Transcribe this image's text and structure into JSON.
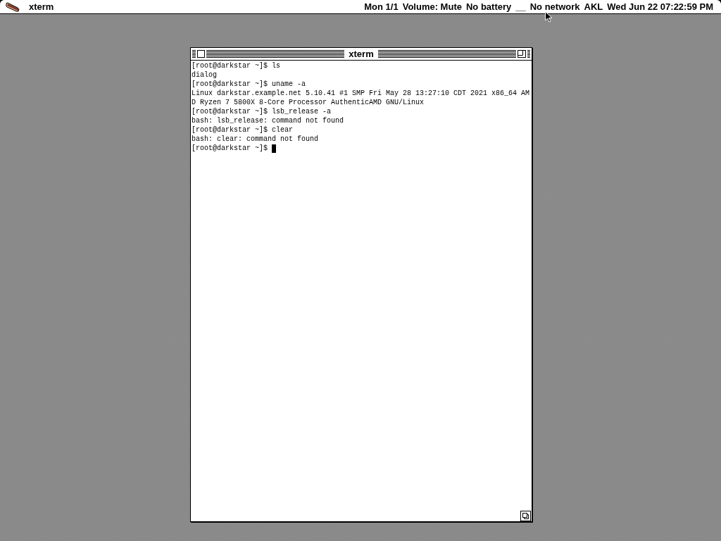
{
  "menu_bar": {
    "app_menu": "xterm",
    "status_items": [
      "Mon 1/1",
      "Volume: Mute",
      "No battery",
      "__",
      "No network",
      "AKL",
      "Wed Jun 22 07:22:59 PM"
    ]
  },
  "window": {
    "title": "xterm",
    "lines": [
      "[root@darkstar ~]$ ls",
      "dialog",
      "[root@darkstar ~]$ uname -a",
      "Linux darkstar.example.net 5.10.41 #1 SMP Fri May 28 13:27:10 CDT 2021 x86_64 AM",
      "D Ryzen 7 5800X 8-Core Processor AuthenticAMD GNU/Linux",
      "[root@darkstar ~]$ lsb_release -a",
      "bash: lsb_release: command not found",
      "[root@darkstar ~]$ clear",
      "bash: clear: command not found",
      "[root@darkstar ~]$"
    ]
  }
}
